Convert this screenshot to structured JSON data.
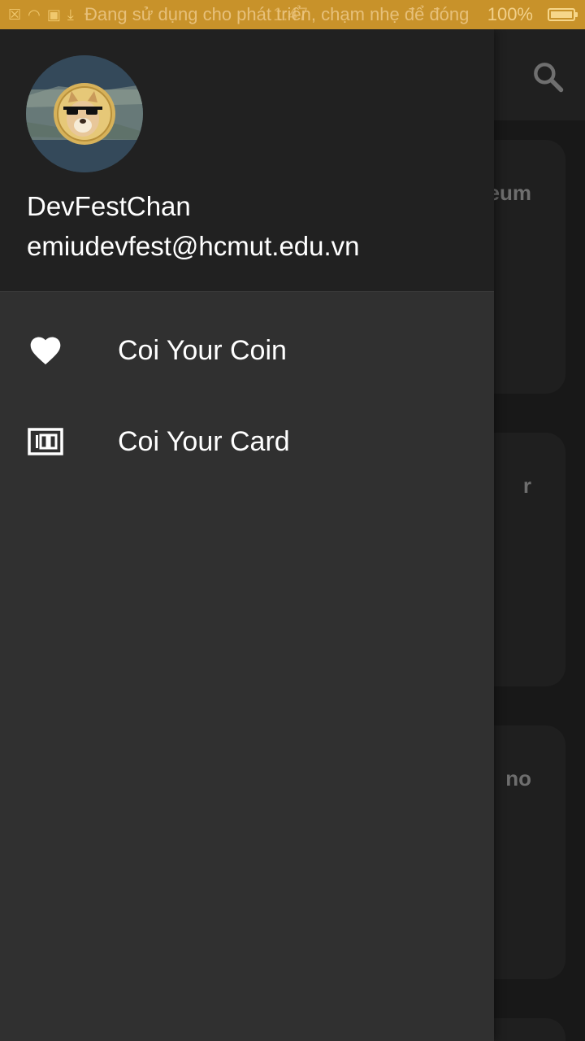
{
  "status_bar": {
    "notification_text": "Đang sử dụng cho phát triển, chạm nhẹ để đóng",
    "time": "1:47",
    "battery_percent": "100%",
    "background_color": "#c8922a"
  },
  "app_bar": {
    "search_icon": "search-icon"
  },
  "background_cards": [
    {
      "title": "eum"
    },
    {
      "title": "r"
    },
    {
      "title": "no"
    }
  ],
  "drawer": {
    "header": {
      "user_name": "DevFestChan",
      "user_email": "emiudevfest@hcmut.edu.vn",
      "avatar": "doge-avatar"
    },
    "menu": [
      {
        "label": "Coi Your Coin",
        "icon": "heart-icon"
      },
      {
        "label": "Coi Your Card",
        "icon": "money-100-icon"
      }
    ]
  }
}
